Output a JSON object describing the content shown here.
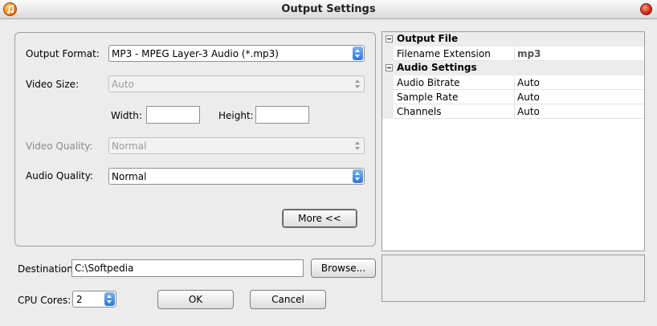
{
  "window": {
    "title": "Output Settings"
  },
  "form": {
    "output_format": {
      "label": "Output Format:",
      "value": "MP3 - MPEG Layer-3 Audio (*.mp3)"
    },
    "video_size": {
      "label": "Video Size:",
      "value": "Auto"
    },
    "width": {
      "label": "Width:",
      "value": ""
    },
    "height": {
      "label": "Height:",
      "value": ""
    },
    "video_quality": {
      "label": "Video Quality:",
      "value": "Normal"
    },
    "audio_quality": {
      "label": "Audio Quality:",
      "value": "Normal"
    },
    "more_button": "More <<"
  },
  "destination": {
    "label": "Destination:",
    "value": "C:\\Softpedia",
    "browse_button": "Browse..."
  },
  "cpu_cores": {
    "label": "CPU Cores:",
    "value": "2"
  },
  "buttons": {
    "ok": "OK",
    "cancel": "Cancel"
  },
  "properties": {
    "output_file": {
      "header": "Output File",
      "rows": [
        {
          "name": "Filename Extension",
          "value": "mp3"
        }
      ]
    },
    "audio_settings": {
      "header": "Audio Settings",
      "rows": [
        {
          "name": "Audio Bitrate",
          "value": "Auto"
        },
        {
          "name": "Sample Rate",
          "value": "Auto"
        },
        {
          "name": "Channels",
          "value": "Auto"
        }
      ]
    }
  },
  "icons": {
    "app": "music-note-icon",
    "close": "close-icon"
  },
  "colors": {
    "accent": "#2f74d8",
    "close": "#d2261a"
  }
}
